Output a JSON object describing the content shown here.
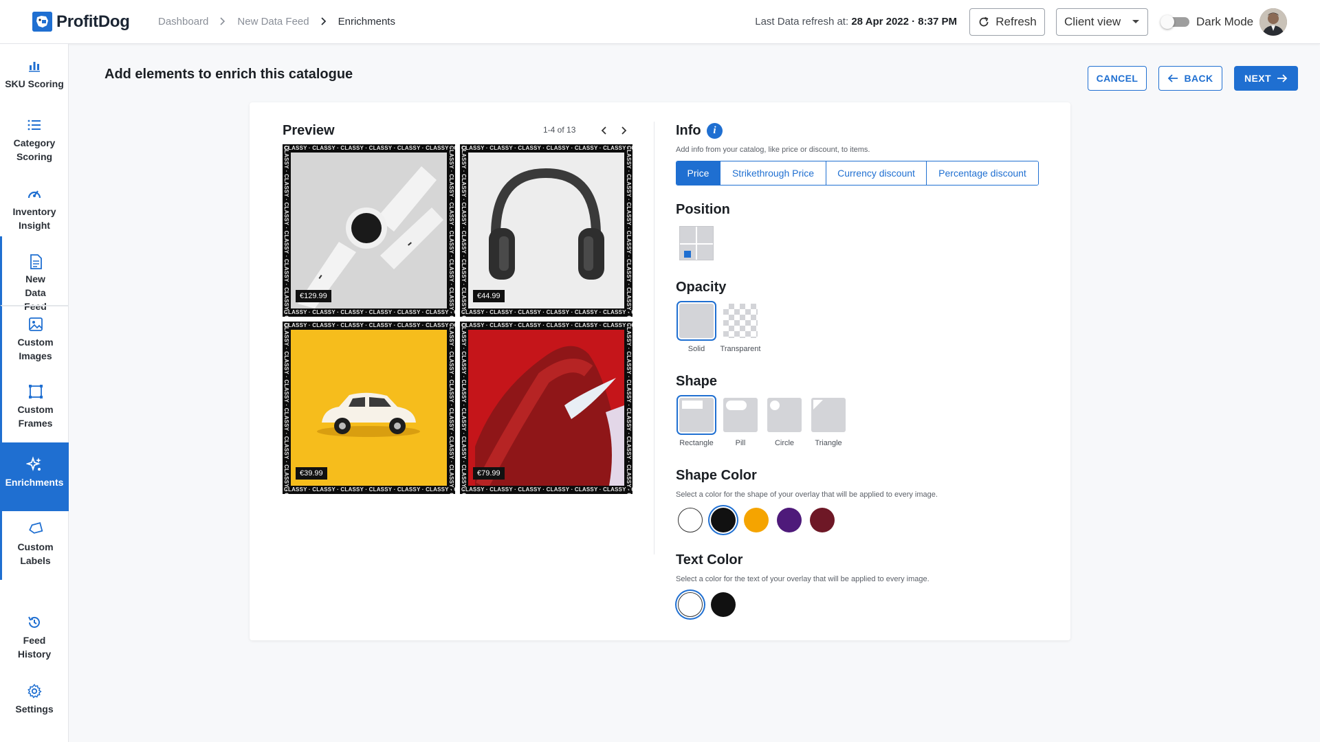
{
  "app": {
    "name": "ProfitDog"
  },
  "breadcrumb": [
    "Dashboard",
    "New Data Feed",
    "Enrichments"
  ],
  "header": {
    "refresh_prefix": "Last Data refresh at:",
    "refresh_value": "28 Apr 2022 · 8:37 PM",
    "refresh_label": "Refresh",
    "view_value": "Client view",
    "dark_mode_label": "Dark Mode",
    "dark_mode_on": false
  },
  "sidebar": {
    "items": [
      {
        "label": "SKU Scoring",
        "icon": "bar-chart-icon"
      },
      {
        "label": "Category Scoring",
        "icon": "list-icon"
      },
      {
        "label": "Inventory Insight",
        "icon": "gauge-icon"
      },
      {
        "label": "New Data Feed",
        "icon": "document-icon"
      },
      {
        "label": "Custom Images",
        "icon": "image-icon"
      },
      {
        "label": "Custom Frames",
        "icon": "frame-icon"
      },
      {
        "label": "Enrichments",
        "icon": "sparkle-icon"
      },
      {
        "label": "Custom Labels",
        "icon": "label-icon"
      },
      {
        "label": "Feed History",
        "icon": "history-icon"
      },
      {
        "label": "Settings",
        "icon": "gear-icon"
      }
    ],
    "active": "Enrichments"
  },
  "page": {
    "title": "Add elements to enrich this catalogue",
    "cancel": "CANCEL",
    "back": "BACK",
    "next": "NEXT"
  },
  "preview": {
    "title": "Preview",
    "pager": "1-4 of 13",
    "frame_text": "CLASSY",
    "tiles": [
      {
        "product": "watch",
        "price": "€129.99",
        "bg": "#d9d9d9"
      },
      {
        "product": "headphones",
        "price": "€44.99",
        "bg": "#ececec"
      },
      {
        "product": "car",
        "price": "€39.99",
        "bg": "#f6bd1c"
      },
      {
        "product": "sneaker",
        "price": "€79.99",
        "bg": "#c8161b"
      }
    ]
  },
  "settings": {
    "info": {
      "title": "Info",
      "desc": "Add info from your catalog, like price or discount, to items.",
      "tabs": [
        "Price",
        "Strikethrough Price",
        "Currency discount",
        "Percentage discount"
      ],
      "active_tab": "Price"
    },
    "position": {
      "title": "Position",
      "selected": "bottom-left"
    },
    "opacity": {
      "title": "Opacity",
      "options": [
        "Solid",
        "Transparent"
      ],
      "selected": "Solid"
    },
    "shape": {
      "title": "Shape",
      "options": [
        "Rectangle",
        "Pill",
        "Circle",
        "Triangle"
      ],
      "selected": "Rectangle"
    },
    "shape_color": {
      "title": "Shape Color",
      "desc": "Select a color for the shape of your overlay that will be applied to every image.",
      "colors": [
        "#ffffff",
        "#111111",
        "#f5a400",
        "#4e1a7a",
        "#6e1826"
      ],
      "selected": "#111111"
    },
    "text_color": {
      "title": "Text Color",
      "desc": "Select a color for the text of your overlay that will be applied to every image.",
      "colors": [
        "#ffffff",
        "#111111"
      ],
      "selected": "#ffffff"
    }
  },
  "colors": {
    "accent": "#1f6fd1"
  }
}
